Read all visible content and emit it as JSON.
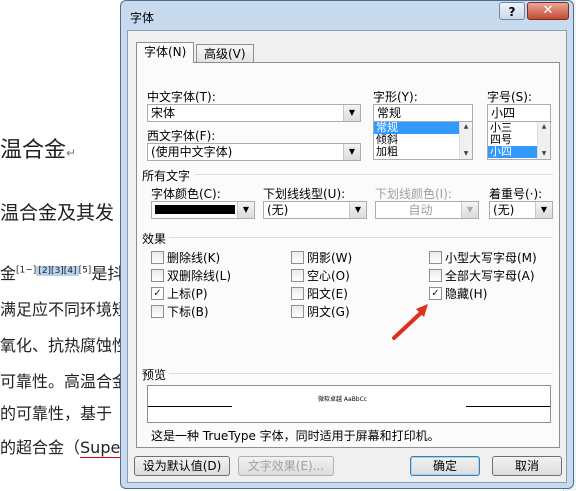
{
  "document": {
    "heading1": "温合金",
    "heading2": "温合金及其发",
    "line1_prefix": "金",
    "line1_cite1": "[1~]",
    "line1_cite2": "[2][3][4]",
    "line1_cite3": "[5]",
    "line1_suffix": "是抖",
    "line2": "满足应不同环境短时",
    "line3": "氧化、抗热腐蚀性",
    "line4": "可靠性。高温合金",
    "line5": "的可靠性，基于",
    "line6_prefix": "的超合金（",
    "line6_suffix": "Super"
  },
  "dialog": {
    "title": "字体",
    "help": "?",
    "close": "✕",
    "tabs": [
      "字体(N)",
      "高级(V)"
    ],
    "chinese_font": {
      "label": "中文字体(T):",
      "value": "宋体"
    },
    "western_font": {
      "label": "西文字体(F):",
      "value": "(使用中文字体)"
    },
    "style": {
      "label": "字形(Y):",
      "value": "常规",
      "options": [
        "常规",
        "倾斜",
        "加粗"
      ],
      "selected": 0
    },
    "size": {
      "label": "字号(S):",
      "value": "小四",
      "options": [
        "小三",
        "四号",
        "小四"
      ],
      "selected": 2
    },
    "all_text": "所有文字",
    "font_color": {
      "label": "字体颜色(C):",
      "color": "#000000"
    },
    "underline": {
      "label": "下划线线型(U):",
      "value": "(无)"
    },
    "underline_color": {
      "label": "下划线颜色(I):",
      "value": "自动"
    },
    "emphasis": {
      "label": "着重号(·):",
      "value": "(无)"
    },
    "effects": {
      "label": "效果",
      "col1": [
        {
          "label": "删除线(K)",
          "checked": false
        },
        {
          "label": "双删除线(L)",
          "checked": false
        },
        {
          "label": "上标(P)",
          "checked": true
        },
        {
          "label": "下标(B)",
          "checked": false
        }
      ],
      "col2": [
        {
          "label": "阴影(W)",
          "checked": false
        },
        {
          "label": "空心(O)",
          "checked": false
        },
        {
          "label": "阳文(E)",
          "checked": false
        },
        {
          "label": "阴文(G)",
          "checked": false
        }
      ],
      "col3": [
        {
          "label": "小型大写字母(M)",
          "checked": false
        },
        {
          "label": "全部大写字母(A)",
          "checked": false
        },
        {
          "label": "隐藏(H)",
          "checked": true
        }
      ]
    },
    "preview": {
      "label": "预览",
      "sample": "微软卓越  AaBbCc",
      "description": "这是一种 TrueType 字体，同时适用于屏幕和打印机。"
    },
    "buttons": {
      "set_default": "设为默认值(D)",
      "text_effects": "文字效果(E)...",
      "ok": "确定",
      "cancel": "取消"
    },
    "colors": {
      "arrow": "#e03020",
      "selection": "#3399ff"
    }
  }
}
